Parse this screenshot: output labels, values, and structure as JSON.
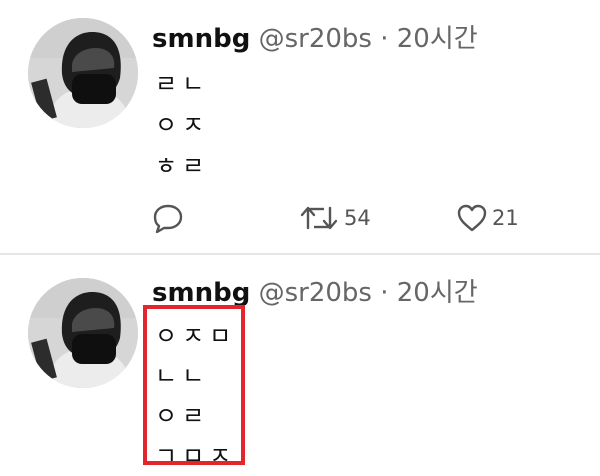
{
  "tweets": [
    {
      "display_name": "smnbg",
      "handle": "@sr20bs",
      "separator": "·",
      "time": "20시간",
      "lines": [
        "ㄹㄴ",
        "ㅇㅈ",
        "ㅎㄹ"
      ],
      "retweet_count": "54",
      "like_count": "21"
    },
    {
      "display_name": "smnbg",
      "handle": "@sr20bs",
      "separator": "·",
      "time": "20시간",
      "lines": [
        "ㅇㅈㅁ",
        "ㄴㄴ",
        "ㅇㄹ",
        "ㄱㅁㅈ"
      ]
    }
  ],
  "colors": {
    "highlight": "#e3262e",
    "name": "#111111",
    "meta": "#666666",
    "icons": "#555555"
  },
  "icons": {
    "reply": "reply-icon",
    "retweet": "retweet-icon",
    "like": "like-icon"
  }
}
